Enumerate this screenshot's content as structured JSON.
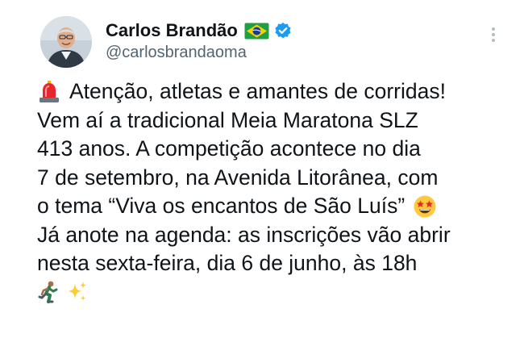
{
  "author": {
    "display_name": "Carlos Brandão",
    "handle": "@carlosbrandaoma",
    "flag_icon": "brazil-flag-icon",
    "verified_icon": "verified-badge-icon",
    "verified_color": "#1d9bf0",
    "avatar_bg": "#c9d3dc"
  },
  "menu": {
    "icon": "more-options-icon"
  },
  "tweet": {
    "lines": [
      "Atenção, atletas e amantes de corridas!",
      "Vem aí a tradicional Meia Maratona SLZ",
      "413 anos. A competição acontece no dia",
      "7 de setembro, na Avenida Litorânea, com",
      "o tema “Viva os encantos de São Luís”",
      "Já anote na agenda: as inscrições vão abrir",
      "nesta sexta-feira, dia 6 de junho, às 18h"
    ],
    "emojis": {
      "siren": "rotating-light-emoji",
      "star_eyes": "star-struck-emoji",
      "runner": "person-running-emoji",
      "sparkles": "sparkles-emoji"
    }
  }
}
